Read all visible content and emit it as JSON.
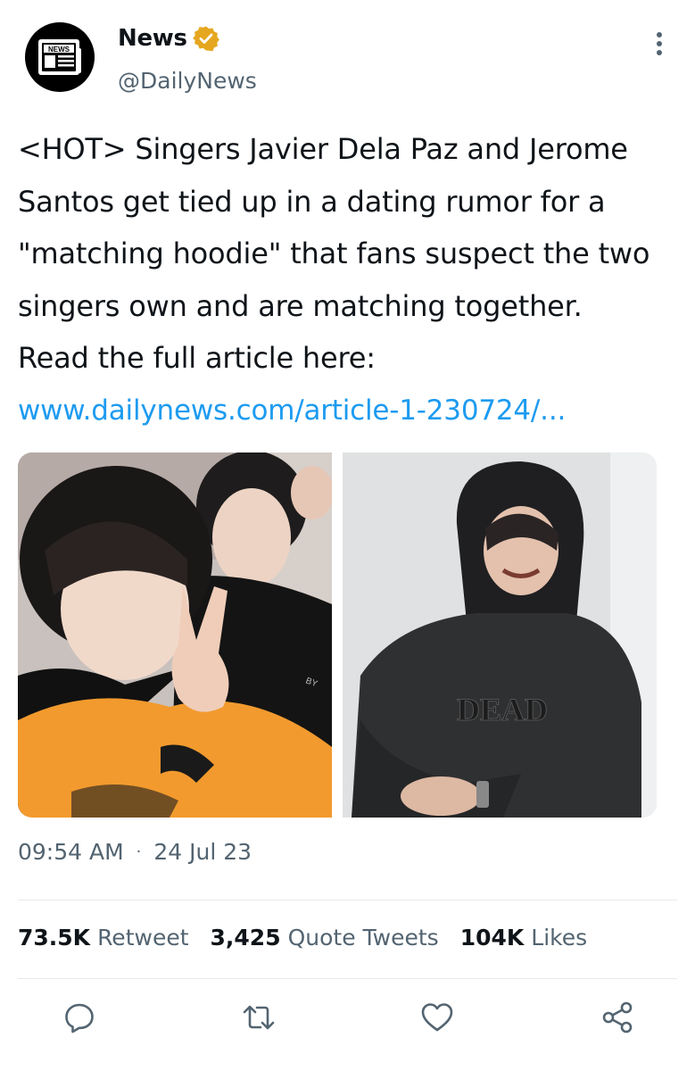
{
  "author": {
    "name": "News",
    "handle": "@DailyNews",
    "avatar_text": "NEWS",
    "verified_icon": "verified-badge-icon",
    "badge_color": "#e5a720"
  },
  "tweet": {
    "text": "<HOT> Singers Javier Dela Paz and Jerome\nSantos get tied up in a dating rumor for a\n\"matching hoodie\" that fans suspect the two\nsingers own and are matching together.\nRead the full article here:",
    "link": "www.dailynews.com/article-1-230724/...",
    "link_color": "#1d9bf0"
  },
  "media": {
    "photo_left_text": "BY",
    "photo_right_text": "DEAD"
  },
  "meta": {
    "time": "09:54 AM",
    "separator": "·",
    "date": "24 Jul 23"
  },
  "stats": {
    "retweets_count": "73.5K",
    "retweets_label": "Retweet",
    "quotes_count": "3,425",
    "quotes_label": "Quote Tweets",
    "likes_count": "104K",
    "likes_label": "Likes"
  },
  "actions": [
    "reply-icon",
    "retweet-icon",
    "like-icon",
    "share-icon"
  ]
}
